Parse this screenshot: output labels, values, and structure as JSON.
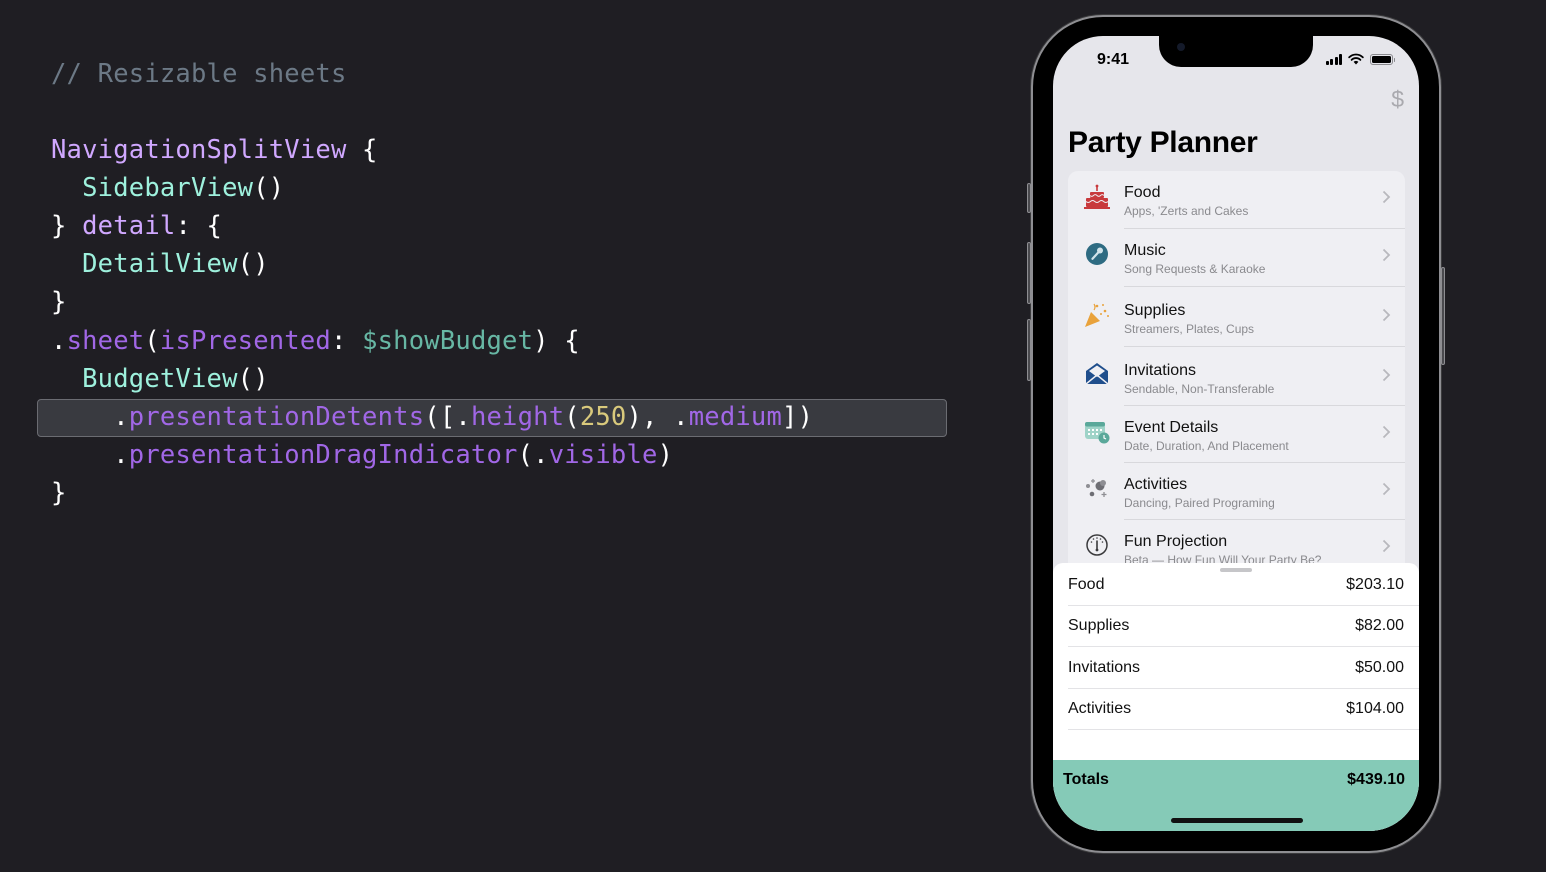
{
  "code": {
    "lines": [
      [
        {
          "t": "// Resizable sheets",
          "c": "comment"
        }
      ],
      [],
      [
        {
          "t": "NavigationSplitView",
          "c": "type"
        },
        {
          "t": " {",
          "c": "plain"
        }
      ],
      [
        {
          "t": "  ",
          "c": "plain"
        },
        {
          "t": "SidebarView",
          "c": "view"
        },
        {
          "t": "()",
          "c": "plain"
        }
      ],
      [
        {
          "t": "} ",
          "c": "plain"
        },
        {
          "t": "detail",
          "c": "kw"
        },
        {
          "t": ": {",
          "c": "plain"
        }
      ],
      [
        {
          "t": "  ",
          "c": "plain"
        },
        {
          "t": "DetailView",
          "c": "view"
        },
        {
          "t": "()",
          "c": "plain"
        }
      ],
      [
        {
          "t": "}",
          "c": "plain"
        }
      ],
      [
        {
          "t": ".",
          "c": "plain"
        },
        {
          "t": "sheet",
          "c": "method"
        },
        {
          "t": "(",
          "c": "plain"
        },
        {
          "t": "isPresented",
          "c": "param"
        },
        {
          "t": ": ",
          "c": "plain"
        },
        {
          "t": "$showBudget",
          "c": "var"
        },
        {
          "t": ") {",
          "c": "plain"
        }
      ],
      [
        {
          "t": "  ",
          "c": "plain"
        },
        {
          "t": "BudgetView",
          "c": "view"
        },
        {
          "t": "()",
          "c": "plain"
        }
      ],
      [
        {
          "t": "    .",
          "c": "plain"
        },
        {
          "t": "presentationDetents",
          "c": "method"
        },
        {
          "t": "([.",
          "c": "plain"
        },
        {
          "t": "height",
          "c": "method"
        },
        {
          "t": "(",
          "c": "plain"
        },
        {
          "t": "250",
          "c": "num"
        },
        {
          "t": "), .",
          "c": "plain"
        },
        {
          "t": "medium",
          "c": "method"
        },
        {
          "t": "])",
          "c": "plain"
        }
      ],
      [
        {
          "t": "    .",
          "c": "plain"
        },
        {
          "t": "presentationDragIndicator",
          "c": "method"
        },
        {
          "t": "(.",
          "c": "plain"
        },
        {
          "t": "visible",
          "c": "method"
        },
        {
          "t": ")",
          "c": "plain"
        }
      ],
      [
        {
          "t": "}",
          "c": "plain"
        }
      ]
    ],
    "highlighted_line": 9
  },
  "phone": {
    "status_bar": {
      "time": "9:41"
    },
    "toolbar": {
      "budget_icon": "dollar-sign-icon",
      "budget_glyph": "$"
    },
    "nav_title": "Party Planner",
    "list": [
      {
        "title": "Food",
        "subtitle": "Apps, 'Zerts and Cakes",
        "icon": "birthday-cake-icon",
        "color": "#c8393c"
      },
      {
        "title": "Music",
        "subtitle": "Song Requests & Karaoke",
        "icon": "microphone-icon",
        "color": "#2e6b82"
      },
      {
        "title": "Supplies",
        "subtitle": "Streamers, Plates, Cups",
        "icon": "party-popper-icon",
        "color": "#e9a23b"
      },
      {
        "title": "Invitations",
        "subtitle": "Sendable, Non-Transferable",
        "icon": "envelope-open-icon",
        "color": "#1f4e8c"
      },
      {
        "title": "Event Details",
        "subtitle": "Date, Duration, And Placement",
        "icon": "calendar-clock-icon",
        "color": "#5aa89a"
      },
      {
        "title": "Activities",
        "subtitle": "Dancing, Paired Programing",
        "icon": "sparkle-dots-icon",
        "color": "#7a7a80"
      },
      {
        "title": "Fun Projection",
        "subtitle": "Beta — How Fun Will Your Party Be?",
        "icon": "gauge-icon",
        "color": "#3a3a3c"
      }
    ],
    "budget_sheet": {
      "rows": [
        {
          "label": "Food",
          "value": "$203.10"
        },
        {
          "label": "Supplies",
          "value": "$82.00"
        },
        {
          "label": "Invitations",
          "value": "$50.00"
        },
        {
          "label": "Activities",
          "value": "$104.00"
        }
      ],
      "totals": {
        "label": "Totals",
        "value": "$439.10",
        "color": "#85cab7"
      }
    }
  }
}
